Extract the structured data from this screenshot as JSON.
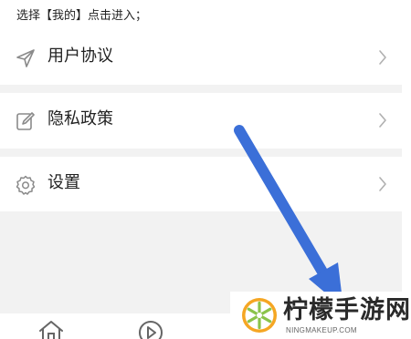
{
  "instruction": "选择【我的】点击进入；",
  "menu": {
    "items": [
      {
        "label": "用户协议",
        "icon": "send-icon"
      },
      {
        "label": "隐私政策",
        "icon": "edit-icon"
      },
      {
        "label": "设置",
        "icon": "gear-icon"
      }
    ]
  },
  "bottom_nav": {
    "items": [
      {
        "icon": "home-icon"
      },
      {
        "icon": "play-circle-icon"
      }
    ]
  },
  "annotation": {
    "arrow_color": "#3b6fd8"
  },
  "watermark": {
    "title": "柠檬手游网",
    "url": "NINGMAKEUP.COM"
  },
  "colors": {
    "background": "#ffffff",
    "divider": "#f2f2f2",
    "text": "#222222",
    "icon": "#8a8a8a",
    "arrow": "#3b6fd8",
    "logo_orange": "#f5a623",
    "logo_green": "#8bc34a"
  }
}
